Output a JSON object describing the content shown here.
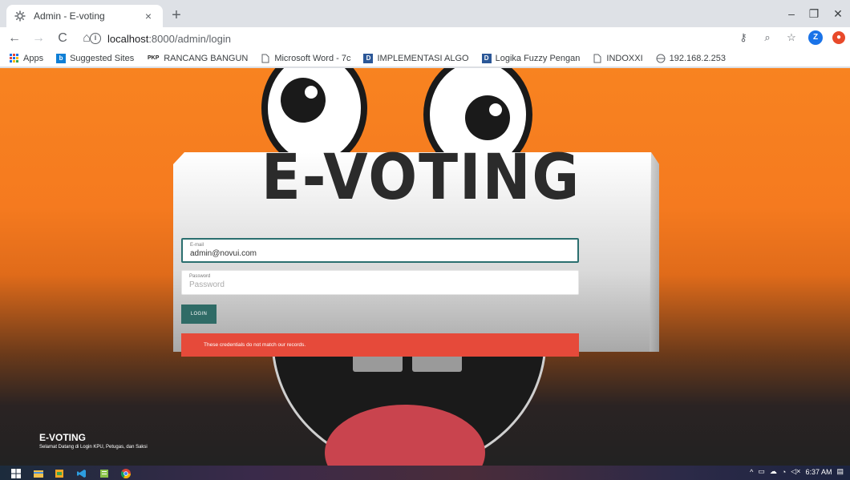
{
  "browser": {
    "tab_title": "Admin - E-voting",
    "tab_close": "×",
    "new_tab": "+",
    "url_host": "localhost",
    "url_path": ":8000/admin/login",
    "window_minimize": "–",
    "window_restore": "❐",
    "window_close": "✕",
    "profile_initial": "Z"
  },
  "bookmarks": [
    {
      "label": "Apps",
      "icon": "apps-grid-icon"
    },
    {
      "label": "Suggested Sites",
      "icon": "bing-icon",
      "color": "#0f7fd6"
    },
    {
      "label": "RANCANG BANGUN",
      "icon": "pkp-icon"
    },
    {
      "label": "Microsoft Word - 7c",
      "icon": "page-icon"
    },
    {
      "label": "IMPLEMENTASI ALGO",
      "icon": "d-icon",
      "color": "#2b5797"
    },
    {
      "label": "Logika Fuzzy Pengan",
      "icon": "d-icon",
      "color": "#2b5797"
    },
    {
      "label": "INDOXXI",
      "icon": "page-icon"
    },
    {
      "label": "192.168.2.253",
      "icon": "globe-icon"
    }
  ],
  "page": {
    "hero_text": "E-VOTING",
    "email": {
      "label": "E-mail",
      "value": "admin@novui.com"
    },
    "password": {
      "label": "Password",
      "placeholder": "Password"
    },
    "login_button": "LOGIN",
    "error_message": "These credentials do not match our records.",
    "footer_title": "E-VOTING",
    "footer_subtitle": "Selamat Datang di Login KPU, Petugas, dan Saksi"
  },
  "taskbar": {
    "clock": "6:37 AM",
    "tray_icons": [
      "chevron-up-icon",
      "network-icon",
      "cloud-icon",
      "wifi-icon",
      "volume-icon"
    ]
  },
  "colors": {
    "accent_orange": "#f88320",
    "button_teal": "#2f6b66",
    "alert_red": "#e64a3a"
  }
}
